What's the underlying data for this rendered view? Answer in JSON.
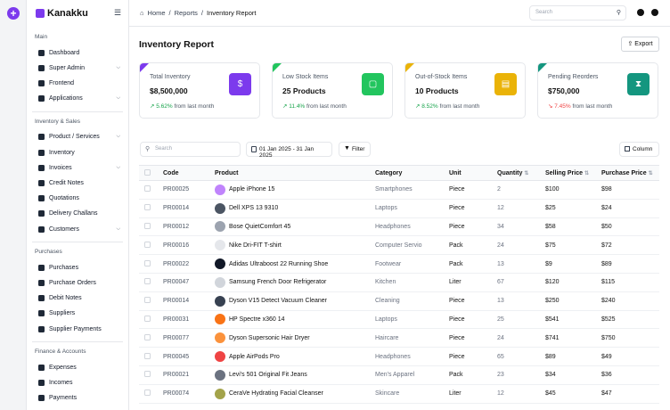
{
  "brand": {
    "name": "Kanakku"
  },
  "sidebar": {
    "sections": [
      {
        "title": "Main",
        "items": [
          {
            "label": "Dashboard",
            "chevron": false
          },
          {
            "label": "Super Admin",
            "chevron": true
          },
          {
            "label": "Frontend",
            "chevron": false
          },
          {
            "label": "Applications",
            "chevron": true
          }
        ]
      },
      {
        "title": "Inventory & Sales",
        "items": [
          {
            "label": "Product / Services",
            "chevron": true
          },
          {
            "label": "Inventory",
            "chevron": false
          },
          {
            "label": "Invoices",
            "chevron": true
          },
          {
            "label": "Credit Notes",
            "chevron": false
          },
          {
            "label": "Quotations",
            "chevron": false
          },
          {
            "label": "Delivery Challans",
            "chevron": false
          },
          {
            "label": "Customers",
            "chevron": true
          }
        ]
      },
      {
        "title": "Purchases",
        "items": [
          {
            "label": "Purchases",
            "chevron": false
          },
          {
            "label": "Purchase Orders",
            "chevron": false
          },
          {
            "label": "Debit Notes",
            "chevron": false
          },
          {
            "label": "Suppliers",
            "chevron": false
          },
          {
            "label": "Supplier Payments",
            "chevron": false
          }
        ]
      },
      {
        "title": "Finance & Accounts",
        "items": [
          {
            "label": "Expenses",
            "chevron": false
          },
          {
            "label": "Incomes",
            "chevron": false
          },
          {
            "label": "Payments",
            "chevron": false
          }
        ]
      }
    ]
  },
  "topbar": {
    "breadcrumbs": [
      "Home",
      "Reports",
      "Inventory Report"
    ],
    "search_placeholder": "Search"
  },
  "page": {
    "title": "Inventory Report",
    "export_label": "Export"
  },
  "cards": [
    {
      "label": "Total Inventory",
      "value": "$8,500,000",
      "change": "5.62%",
      "change_suffix": "from last month",
      "trend": "up",
      "color": "#7c3aed",
      "icon": "dollar-icon"
    },
    {
      "label": "Low Stock Items",
      "value": "25 Products",
      "change": "11.4%",
      "change_suffix": "from last month",
      "trend": "up",
      "color": "#22c55e",
      "icon": "bag-icon"
    },
    {
      "label": "Out-of-Stock Items",
      "value": "10 Products",
      "change": "8.52%",
      "change_suffix": "from last month",
      "trend": "up",
      "color": "#eab308",
      "icon": "basket-icon"
    },
    {
      "label": "Pending Reorders",
      "value": "$750,000",
      "change": "7.45%",
      "change_suffix": "from last month",
      "trend": "down",
      "color": "#14967f",
      "icon": "hourglass-icon"
    }
  ],
  "toolbar": {
    "search_placeholder": "Search",
    "date_range": "01 Jan 2025 - 31 Jan 2025",
    "filter_label": "Filter",
    "column_label": "Column"
  },
  "table": {
    "columns": [
      "Code",
      "Product",
      "Category",
      "Unit",
      "Quantity",
      "Selling Price",
      "Purchase Price"
    ],
    "rows": [
      {
        "code": "PR00025",
        "product": "Apple iPhone 15",
        "category": "Smartphones",
        "unit": "Piece",
        "qty": "2",
        "sell": "$100",
        "buy": "$98",
        "img": "#c084fc"
      },
      {
        "code": "PR00014",
        "product": "Dell XPS 13 9310",
        "category": "Laptops",
        "unit": "Piece",
        "qty": "12",
        "sell": "$25",
        "buy": "$24",
        "img": "#4b5563"
      },
      {
        "code": "PR00012",
        "product": "Bose QuietComfort 45",
        "category": "Headphones",
        "unit": "Piece",
        "qty": "34",
        "sell": "$58",
        "buy": "$50",
        "img": "#9ca3af"
      },
      {
        "code": "PR00016",
        "product": "Nike Dri-FIT T-shirt",
        "category": "Computer Servio",
        "unit": "Pack",
        "qty": "24",
        "sell": "$75",
        "buy": "$72",
        "img": "#e5e7eb"
      },
      {
        "code": "PR00022",
        "product": "Adidas Ultraboost 22 Running Shoe",
        "category": "Footwear",
        "unit": "Pack",
        "qty": "13",
        "sell": "$9",
        "buy": "$89",
        "img": "#111827"
      },
      {
        "code": "PR00047",
        "product": "Samsung French Door Refrigerator",
        "category": "Kitchen",
        "unit": "Liter",
        "qty": "67",
        "sell": "$120",
        "buy": "$115",
        "img": "#d1d5db"
      },
      {
        "code": "PR00014",
        "product": "Dyson V15 Detect  Vacuum Cleaner",
        "category": "Cleaning",
        "unit": "Piece",
        "qty": "13",
        "sell": "$250",
        "buy": "$240",
        "img": "#374151"
      },
      {
        "code": "PR00031",
        "product": "HP Spectre x360 14",
        "category": "Laptops",
        "unit": "Piece",
        "qty": "25",
        "sell": "$541",
        "buy": "$525",
        "img": "#f97316"
      },
      {
        "code": "PR00077",
        "product": "Dyson Supersonic Hair Dryer",
        "category": "Haircare",
        "unit": "Piece",
        "qty": "24",
        "sell": "$741",
        "buy": "$750",
        "img": "#fb923c"
      },
      {
        "code": "PR00045",
        "product": "Apple AirPods Pro",
        "category": "Headphones",
        "unit": "Piece",
        "qty": "65",
        "sell": "$89",
        "buy": "$49",
        "img": "#ef4444"
      },
      {
        "code": "PR00021",
        "product": "Levi's 501 Original Fit Jeans",
        "category": "Men's Apparel",
        "unit": "Pack",
        "qty": "23",
        "sell": "$34",
        "buy": "$36",
        "img": "#6b7280"
      },
      {
        "code": "PR00074",
        "product": "CeraVe Hydrating Facial Cleanser",
        "category": "Skincare",
        "unit": "Liter",
        "qty": "12",
        "sell": "$45",
        "buy": "$47",
        "img": "#a3a34a"
      }
    ]
  }
}
